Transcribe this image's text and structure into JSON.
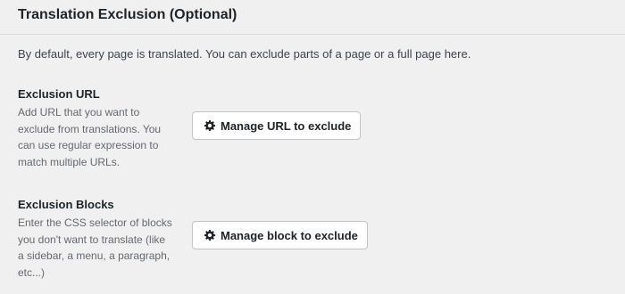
{
  "section": {
    "title": "Translation Exclusion (Optional)",
    "intro": "By default, every page is translated. You can exclude parts of a page or a full page here."
  },
  "exclusion_url": {
    "label": "Exclusion URL",
    "description": "Add URL that you want to exclude from translations. You can use regular expression to match multiple URLs.",
    "button_label": "Manage URL to exclude",
    "button_icon": "gear-icon"
  },
  "exclusion_blocks": {
    "label": "Exclusion Blocks",
    "description": "Enter the CSS selector of blocks you don't want to translate (like a sidebar, a menu, a paragraph, etc...)",
    "button_label": "Manage block to exclude",
    "button_icon": "gear-icon"
  }
}
